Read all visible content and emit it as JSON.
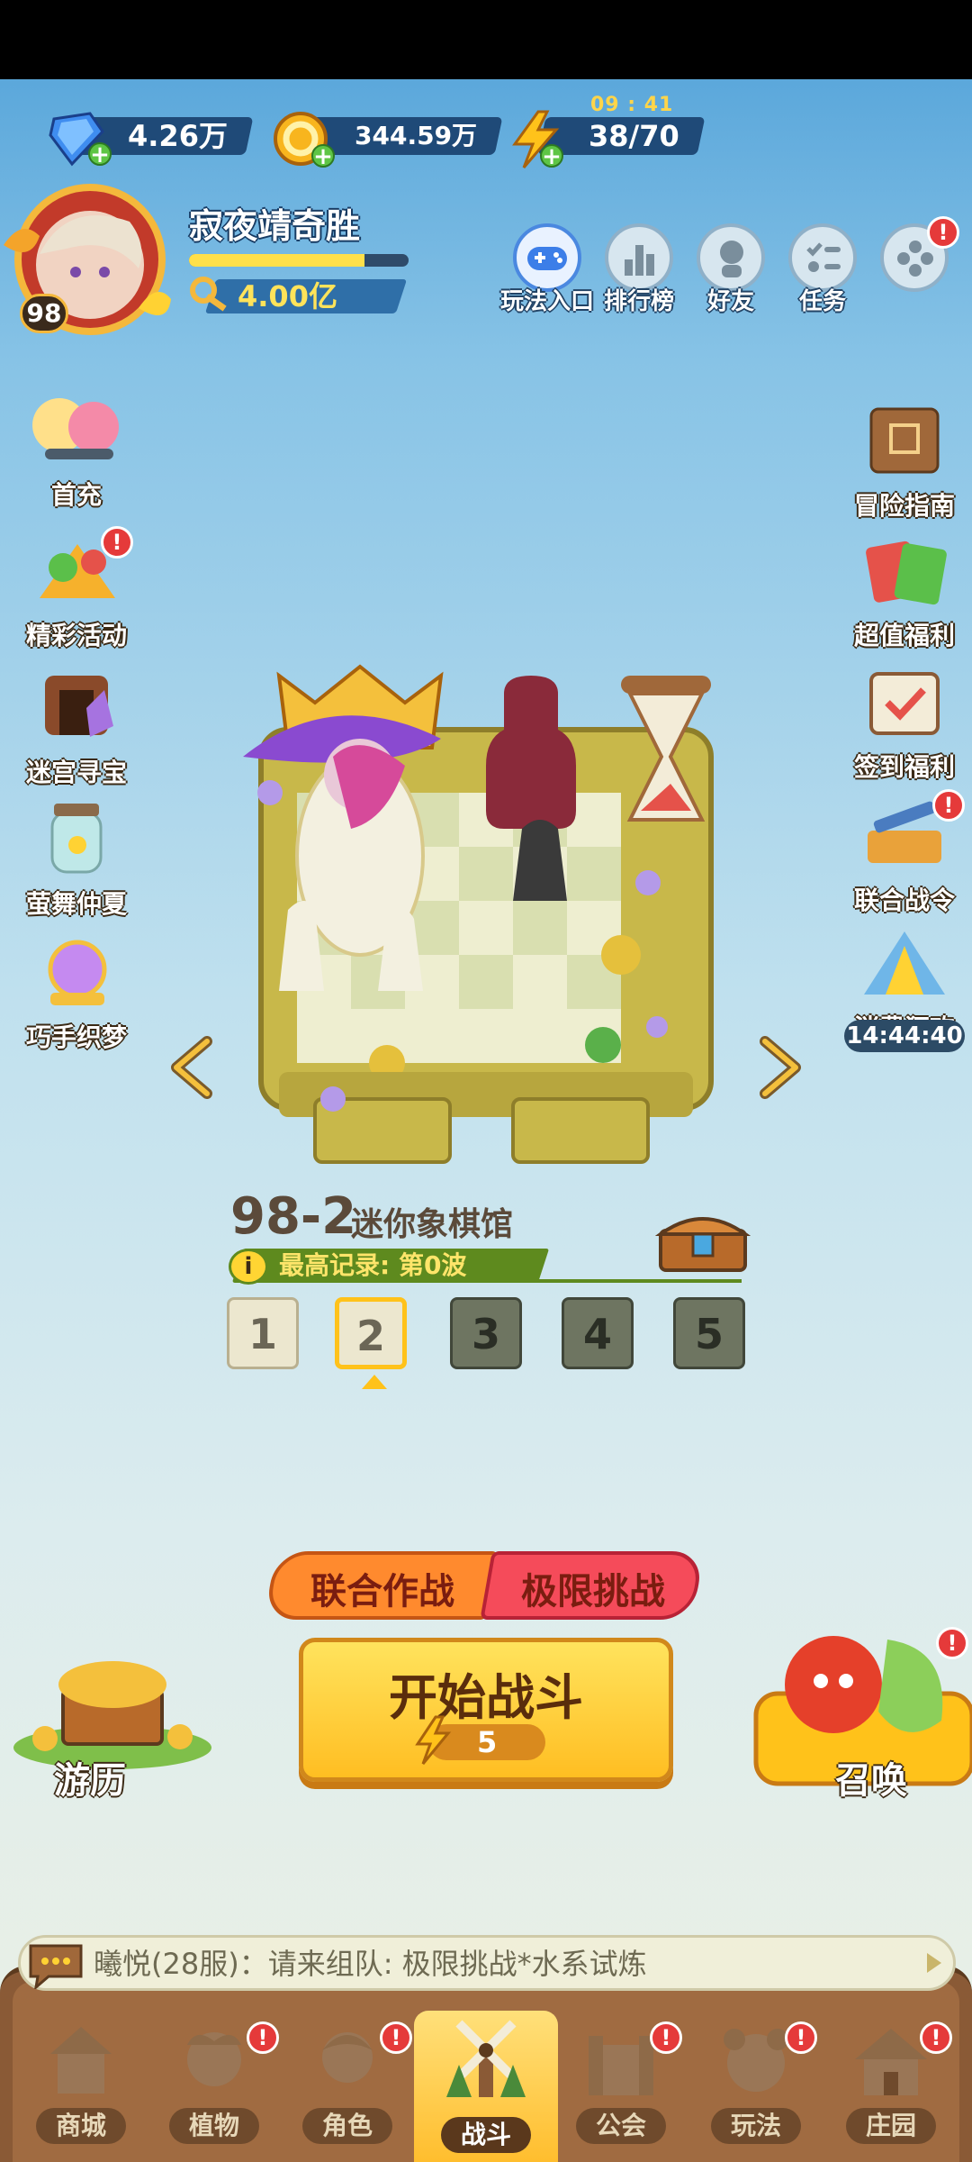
{
  "resources": {
    "diamonds": "4.26万",
    "coins": "344.59万",
    "energy": "38/70",
    "energy_timer": "09 : 41"
  },
  "player": {
    "name": "寂夜靖奇胜",
    "level": "98",
    "power": "4.00亿",
    "xp_fraction": 0.8
  },
  "top_buttons": {
    "play_entry": "玩法入口",
    "leaderboard": "排行榜",
    "friends": "好友",
    "tasks": "任务",
    "badge": "!"
  },
  "left_menu": [
    "首充",
    "精彩活动",
    "迷宫寻宝",
    "萤舞仲夏",
    "巧手织梦"
  ],
  "right_menu": [
    "冒险指南",
    "超值福利",
    "签到福利",
    "联合战令",
    "消费狂欢"
  ],
  "event_countdown": "14:44:40",
  "stage": {
    "number": "98-2",
    "name": "迷你象棋馆",
    "record_icon": "i",
    "record": "最高记录: 第0波",
    "substages": [
      "1",
      "2",
      "3",
      "4",
      "5"
    ],
    "current_substage": 2
  },
  "modes": {
    "coop": "联合作战",
    "extreme": "极限挑战"
  },
  "start": {
    "label": "开始战斗",
    "cost": "5"
  },
  "side_actions": {
    "travel": "游历",
    "summon": "召唤"
  },
  "chat": {
    "message": "曦悦(28服)：请来组队: 极限挑战*水系试炼"
  },
  "nav": {
    "tabs": [
      "商城",
      "植物",
      "角色",
      "战斗",
      "公会",
      "玩法",
      "庄园"
    ],
    "active": "战斗"
  },
  "colors": {
    "accent_yellow": "#ffc21a",
    "badge_red": "#e53a3a",
    "nav_brown": "#8a5a36"
  }
}
